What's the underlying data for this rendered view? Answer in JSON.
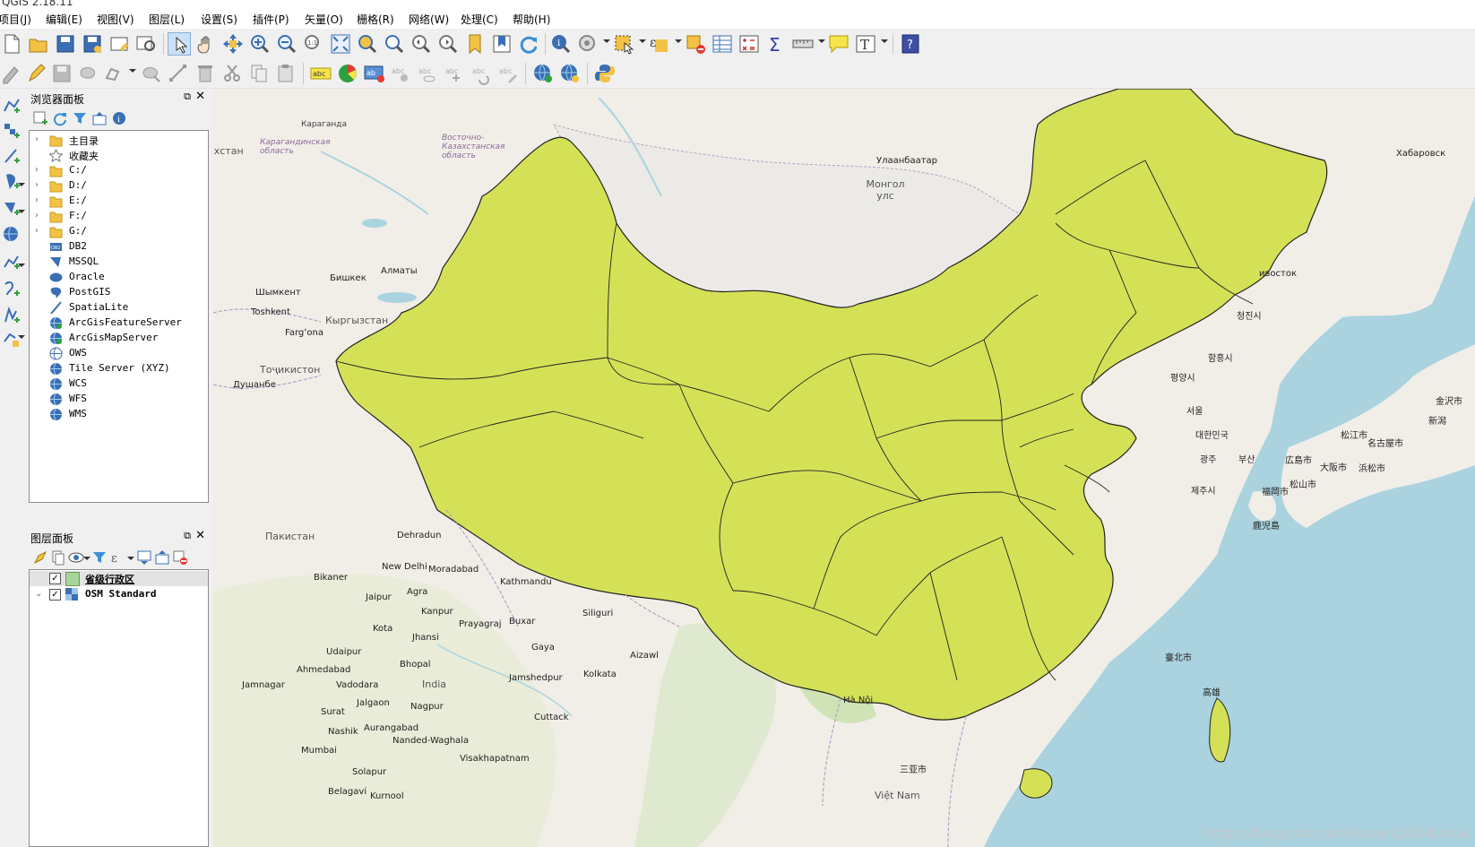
{
  "window": {
    "title": "QGIS 2.18.11"
  },
  "menu": [
    "项目(J)",
    "编辑(E)",
    "视图(V)",
    "图层(L)",
    "设置(S)",
    "插件(P)",
    "矢量(O)",
    "栅格(R)",
    "网络(W)",
    "处理(C)",
    "帮助(H)"
  ],
  "browser_panel": {
    "title": "浏览器面板",
    "items": [
      {
        "label": "主目录",
        "icon": "folder-icon",
        "expand": true
      },
      {
        "label": "收藏夹",
        "icon": "star-icon",
        "expand": false
      },
      {
        "label": "C:/",
        "icon": "folder-icon",
        "expand": true
      },
      {
        "label": "D:/",
        "icon": "folder-icon",
        "expand": true
      },
      {
        "label": "E:/",
        "icon": "folder-icon",
        "expand": true
      },
      {
        "label": "F:/",
        "icon": "folder-icon",
        "expand": true
      },
      {
        "label": "G:/",
        "icon": "folder-icon",
        "expand": true
      },
      {
        "label": "DB2",
        "icon": "db2-icon",
        "expand": false
      },
      {
        "label": "MSSQL",
        "icon": "mssql-icon",
        "expand": false
      },
      {
        "label": "Oracle",
        "icon": "oracle-icon",
        "expand": false
      },
      {
        "label": "PostGIS",
        "icon": "postgis-icon",
        "expand": false
      },
      {
        "label": "SpatiaLite",
        "icon": "spatialite-icon",
        "expand": false
      },
      {
        "label": "ArcGisFeatureServer",
        "icon": "globe-icon",
        "expand": false
      },
      {
        "label": "ArcGisMapServer",
        "icon": "globe-icon",
        "expand": false
      },
      {
        "label": "OWS",
        "icon": "globe-icon",
        "expand": false
      },
      {
        "label": "Tile Server (XYZ)",
        "icon": "globe-icon",
        "expand": false
      },
      {
        "label": "WCS",
        "icon": "globe-icon",
        "expand": false
      },
      {
        "label": "WFS",
        "icon": "globe-icon",
        "expand": false
      },
      {
        "label": "WMS",
        "icon": "globe-icon",
        "expand": false
      }
    ]
  },
  "layers_panel": {
    "title": "图层面板",
    "layers": [
      {
        "label": "省级行政区",
        "checked": true,
        "color": "#a6d49a",
        "selected": true
      },
      {
        "label": "OSM Standard",
        "checked": true,
        "selected": false
      }
    ]
  },
  "map": {
    "fill_color": "#d4e157",
    "labels": [
      {
        "t": "Караганда"
      },
      {
        "t": "Карагандинская область"
      },
      {
        "t": "Восточно-Казахстанская область"
      },
      {
        "t": "ахстан"
      },
      {
        "t": "Улаанбаатар"
      },
      {
        "t": "Монгол улс"
      },
      {
        "t": "Хабаровск"
      },
      {
        "t": "Алматы"
      },
      {
        "t": "Бишкек"
      },
      {
        "t": "Шымкент"
      },
      {
        "t": "Кыргызстан"
      },
      {
        "t": "Toshkent"
      },
      {
        "t": "Fargʻona"
      },
      {
        "t": "Тоҷикистон"
      },
      {
        "t": "Душанбе"
      },
      {
        "t": "Dehradun"
      },
      {
        "t": "New Delhi"
      },
      {
        "t": "Moradabad"
      },
      {
        "t": "Kathmandu"
      },
      {
        "t": "Jaipur"
      },
      {
        "t": "Agra"
      },
      {
        "t": "Kanpur"
      },
      {
        "t": "Prayagraj"
      },
      {
        "t": "Buxar"
      },
      {
        "t": "Siliguri"
      },
      {
        "t": "Bikaner"
      },
      {
        "t": "Kota"
      },
      {
        "t": "Jhansi"
      },
      {
        "t": "Udaipur"
      },
      {
        "t": "Bhopal"
      },
      {
        "t": "Gaya"
      },
      {
        "t": "Ahmedabad"
      },
      {
        "t": "India"
      },
      {
        "t": "Vadodara"
      },
      {
        "t": "Jamshedpur"
      },
      {
        "t": "Kolkata"
      },
      {
        "t": "Jamnagar"
      },
      {
        "t": "Jalgaon"
      },
      {
        "t": "Nagpur"
      },
      {
        "t": "Surat"
      },
      {
        "t": "Cuttack"
      },
      {
        "t": "Aurangabad"
      },
      {
        "t": "Nashik"
      },
      {
        "t": "Nanded-Waghala"
      },
      {
        "t": "Mumbai"
      },
      {
        "t": "Visakhapatnam"
      },
      {
        "t": "Solapur"
      },
      {
        "t": "Belagavi"
      },
      {
        "t": "Kurnool"
      },
      {
        "t": "Aizawl"
      },
      {
        "t": "Hà Nội"
      },
      {
        "t": "Việt Nam"
      },
      {
        "t": "대한민국"
      },
      {
        "t": "서울"
      },
      {
        "t": "평양시"
      },
      {
        "t": "함흥시"
      },
      {
        "t": "청진시"
      },
      {
        "t": "부산"
      },
      {
        "t": "광주"
      },
      {
        "t": "제주시"
      },
      {
        "t": "福岡市"
      },
      {
        "t": "松山市"
      },
      {
        "t": "広島市"
      },
      {
        "t": "松江市"
      },
      {
        "t": "名古屋市"
      },
      {
        "t": "大阪市"
      },
      {
        "t": "浜松市"
      },
      {
        "t": "金沢市"
      },
      {
        "t": "新潟"
      },
      {
        "t": "鹿児島"
      },
      {
        "t": "臺北市"
      },
      {
        "t": "高雄"
      },
      {
        "t": "三亚市"
      },
      {
        "t": "ивосток"
      },
      {
        "t": "Пакистан"
      }
    ]
  },
  "watermark": "https://blog.csdn.net/Vincent2014Linux"
}
